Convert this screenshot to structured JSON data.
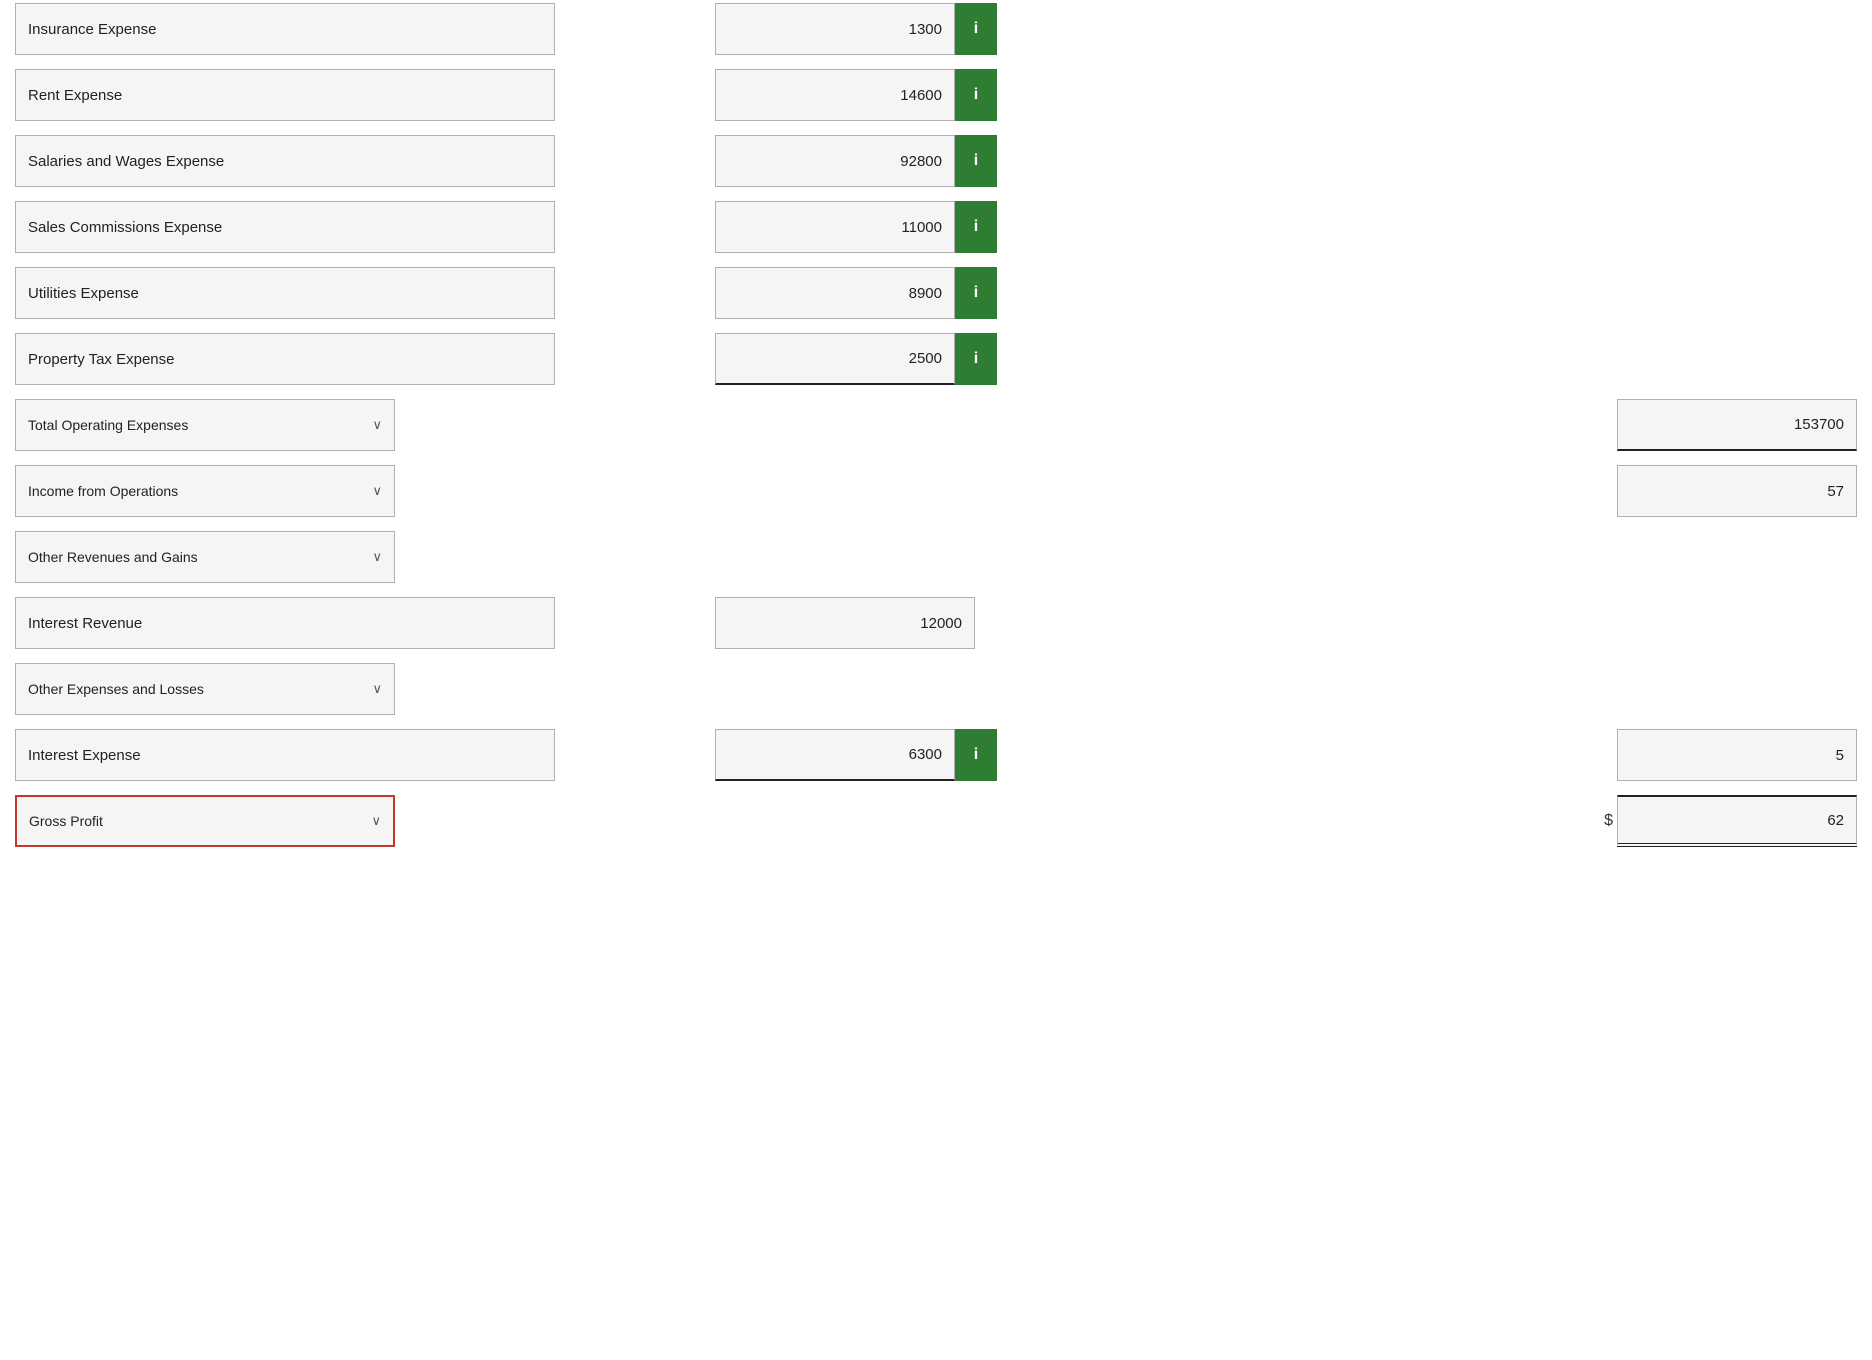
{
  "rows": [
    {
      "id": "insurance-expense",
      "type": "input-with-info",
      "label": "Insurance Expense",
      "value": "1300",
      "showInfo": true,
      "truncated": true
    },
    {
      "id": "rent-expense",
      "type": "input-with-info",
      "label": "Rent Expense",
      "value": "14600",
      "showInfo": true
    },
    {
      "id": "salaries-wages",
      "type": "input-with-info",
      "label": "Salaries and Wages Expense",
      "value": "92800",
      "showInfo": true
    },
    {
      "id": "sales-commissions",
      "type": "input-with-info",
      "label": "Sales Commissions Expense",
      "value": "11000",
      "showInfo": true
    },
    {
      "id": "utilities-expense",
      "type": "input-with-info",
      "label": "Utilities Expense",
      "value": "8900",
      "showInfo": true
    },
    {
      "id": "property-tax",
      "type": "input-with-info",
      "label": "Property Tax Expense",
      "value": "2500",
      "showInfo": true,
      "underline": true
    },
    {
      "id": "total-operating",
      "type": "dropdown-with-total",
      "label": "Total Operating Expenses",
      "totalValue": "153700",
      "underline": true
    },
    {
      "id": "income-operations",
      "type": "dropdown-with-total",
      "label": "Income from Operations",
      "totalValue": "57",
      "partialRight": true
    },
    {
      "id": "other-revenues",
      "type": "dropdown-only",
      "label": "Other Revenues and Gains"
    },
    {
      "id": "interest-revenue",
      "type": "input-no-info",
      "label": "Interest Revenue",
      "value": "12000"
    },
    {
      "id": "other-expenses",
      "type": "dropdown-only",
      "label": "Other Expenses and Losses"
    },
    {
      "id": "interest-expense",
      "type": "input-with-info-and-right",
      "label": "Interest Expense",
      "value": "6300",
      "showInfo": true,
      "rightValue": "5",
      "underline": true
    },
    {
      "id": "gross-profit",
      "type": "dropdown-with-dollar-total",
      "label": "Gross Profit",
      "dollarSign": "$",
      "totalValue": "62",
      "highlighted": true
    }
  ],
  "labels": {
    "info_icon": "i",
    "chevron": "∨"
  }
}
